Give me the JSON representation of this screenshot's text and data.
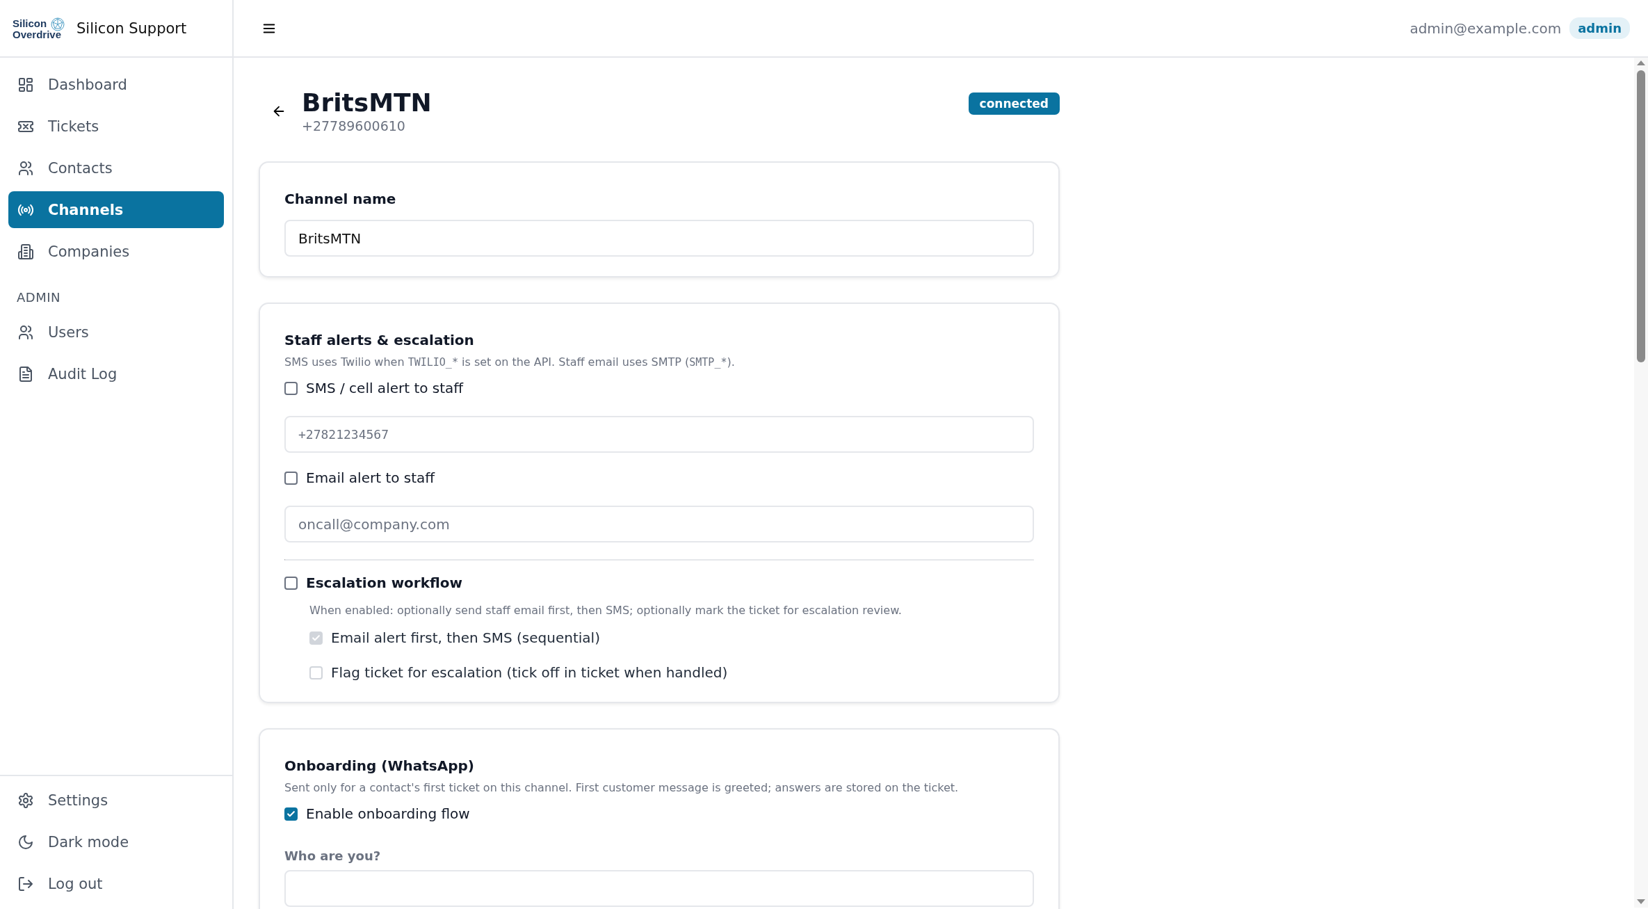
{
  "brand": {
    "logo_lines": [
      "Silicon",
      "Overdrive"
    ],
    "title": "Silicon Support"
  },
  "topbar": {
    "user_email": "admin@example.com",
    "role_badge": "admin"
  },
  "sidebar": {
    "items": [
      {
        "label": "Dashboard",
        "kind": "grid",
        "selected": false
      },
      {
        "label": "Tickets",
        "kind": "ticket",
        "selected": false
      },
      {
        "label": "Contacts",
        "kind": "users",
        "selected": false
      },
      {
        "label": "Channels",
        "kind": "radio",
        "selected": true
      },
      {
        "label": "Companies",
        "kind": "building",
        "selected": false
      }
    ],
    "admin_heading": "ADMIN",
    "admin_items": [
      {
        "label": "Users",
        "kind": "users",
        "selected": false
      },
      {
        "label": "Audit Log",
        "kind": "file",
        "selected": false
      }
    ],
    "footer_items": [
      {
        "label": "Settings",
        "kind": "gear"
      },
      {
        "label": "Dark mode",
        "kind": "moon"
      },
      {
        "label": "Log out",
        "kind": "logout"
      }
    ]
  },
  "header": {
    "title": "BritsMTN",
    "phone": "+27789600610",
    "status": "connected"
  },
  "cards": [
    {
      "rows": [
        {
          "kind": "field_label",
          "text": "Channel name"
        },
        {
          "kind": "input",
          "value": "BritsMTN"
        }
      ]
    },
    {
      "title": "Staff alerts & escalation",
      "description": [
        {
          "text": "SMS uses Twilio when ",
          "code": false
        },
        {
          "text": "TWILIO_*",
          "code": true
        },
        {
          "text": " is set on the API. Staff email uses SMTP (",
          "code": false
        },
        {
          "text": "SMTP_*",
          "code": true
        },
        {
          "text": ").",
          "code": false
        }
      ],
      "rows": [
        {
          "kind": "checkbox",
          "label": "SMS / cell alert to staff",
          "checked": false,
          "disabled": false
        },
        {
          "kind": "input",
          "placeholder": "+27821234567",
          "mono": true
        },
        {
          "kind": "checkbox",
          "label": "Email alert to staff",
          "checked": false,
          "disabled": false
        },
        {
          "kind": "input",
          "placeholder": "oncall@company.com",
          "mono": false
        },
        {
          "kind": "divider"
        },
        {
          "kind": "checkbox_heading",
          "label": "Escalation workflow",
          "checked": false,
          "disabled": false
        },
        {
          "kind": "help",
          "text": "When enabled: optionally send staff email first, then SMS; optionally mark the ticket for escalation review."
        },
        {
          "kind": "sub_checkbox",
          "label": "Email alert first, then SMS (sequential)",
          "checked": true,
          "disabled": true
        },
        {
          "kind": "sub_checkbox",
          "label": "Flag ticket for escalation (tick off in ticket when handled)",
          "checked": false,
          "disabled": true
        }
      ]
    },
    {
      "title": "Onboarding (WhatsApp)",
      "description": [
        {
          "text": "Sent only for a contact's first ticket on this channel. First customer message is greeted; answers are stored on the ticket.",
          "code": false
        }
      ],
      "rows": [
        {
          "kind": "checkbox",
          "label": "Enable onboarding flow",
          "checked": true,
          "disabled": false
        },
        {
          "kind": "small_label",
          "text": "Who are you?"
        },
        {
          "kind": "input"
        }
      ]
    }
  ]
}
